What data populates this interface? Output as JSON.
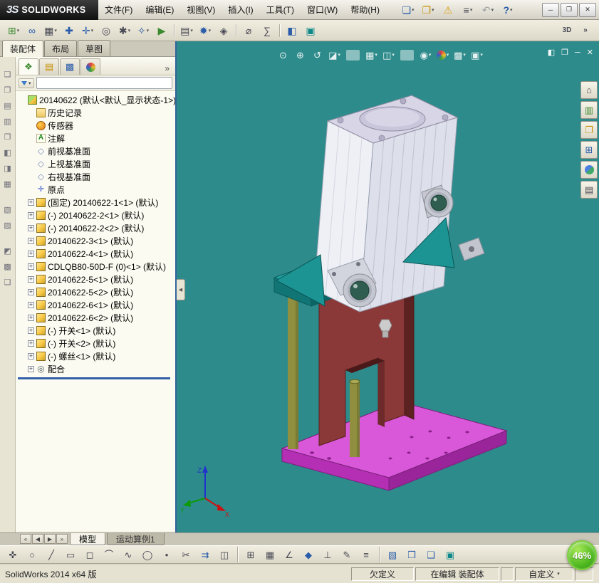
{
  "window": {
    "logo_prefix": "3S",
    "logo_text": "SOLIDWORKS",
    "controls": [
      {
        "name": "minimize-button",
        "g": "─"
      },
      {
        "name": "maximize-button",
        "g": "❐"
      },
      {
        "name": "close-button",
        "g": "✕"
      }
    ]
  },
  "menubar": {
    "items": [
      "文件(F)",
      "编辑(E)",
      "视图(V)",
      "插入(I)",
      "工具(T)",
      "窗口(W)",
      "帮助(H)"
    ]
  },
  "quickbar": {
    "icons": [
      {
        "name": "new-document-icon",
        "g": "❏",
        "c": "c-blue",
        "caret": "▾"
      },
      {
        "name": "open-document-icon",
        "g": "❐",
        "c": "c-gold",
        "caret": "▾"
      },
      {
        "name": "alert-icon",
        "g": "⚠",
        "c": "c-warn"
      },
      {
        "name": "print-icon",
        "g": "≡",
        "c": "c-dark",
        "caret": "▾"
      },
      {
        "name": "undo-icon",
        "g": "↶",
        "c": "c-gray",
        "caret": "▾"
      },
      {
        "name": "help-icon",
        "g": "?",
        "c": "c-help",
        "caret": "▾"
      }
    ]
  },
  "toolbar2": {
    "icons": [
      {
        "name": "insert-components-icon",
        "g": "⊞",
        "c": "c-green",
        "caret": "▾"
      },
      {
        "name": "mate-icon",
        "g": "∞",
        "c": "c-blue"
      },
      {
        "name": "linear-component-pattern-icon",
        "g": "▦",
        "c": "c-dark",
        "caret": "▾"
      },
      {
        "name": "smart-fasteners-icon",
        "g": "✚",
        "c": "c-blue"
      },
      {
        "name": "move-component-icon",
        "g": "✛",
        "c": "c-blue",
        "caret": "▾"
      },
      {
        "name": "show-hidden-components-icon",
        "g": "◎",
        "c": "c-dark"
      },
      {
        "name": "assembly-features-icon",
        "g": "✱",
        "c": "c-dark",
        "caret": "▾"
      },
      {
        "name": "reference-geometry-icon",
        "g": "✧",
        "c": "c-blue",
        "caret": "▾"
      },
      {
        "name": "new-motion-study-icon",
        "g": "▶",
        "c": "c-green"
      },
      {
        "name": "separator",
        "cls": "sep",
        "inter": false
      },
      {
        "name": "bill-of-materials-icon",
        "g": "▤",
        "c": "c-dark",
        "caret": "▾"
      },
      {
        "name": "exploded-view-icon",
        "g": "✹",
        "c": "c-blue",
        "caret": "▾"
      },
      {
        "name": "interference-detection-icon",
        "g": "◈",
        "c": "c-dark"
      },
      {
        "name": "separator",
        "cls": "sep",
        "inter": false
      },
      {
        "name": "measure-icon",
        "g": "⌀",
        "c": "c-dark"
      },
      {
        "name": "mass-properties-icon",
        "g": "∑",
        "c": "c-dark"
      },
      {
        "name": "separator",
        "cls": "sep",
        "inter": false
      },
      {
        "name": "section-view-tool-icon",
        "g": "◧",
        "c": "c-blue"
      },
      {
        "name": "camera-views-icon",
        "g": "▣",
        "c": "c-teal"
      }
    ],
    "right_icons": [
      {
        "name": "standard-views-icon",
        "g": "3D",
        "c": "c-dark"
      },
      {
        "name": "toolbar-overflow-icon",
        "g": "»",
        "c": "c-dark"
      }
    ]
  },
  "command_tabs": {
    "tabs": [
      {
        "name": "tab-assembly",
        "label": "装配体",
        "cls": "active"
      },
      {
        "name": "tab-layout",
        "label": "布局"
      },
      {
        "name": "tab-sketch",
        "label": "草图"
      }
    ]
  },
  "side_toolbar": {
    "icons": [
      {
        "name": "side-toolbar-button-1",
        "g": "❏"
      },
      {
        "name": "side-toolbar-button-2",
        "g": "❒"
      },
      {
        "name": "side-toolbar-button-3",
        "g": "▤"
      },
      {
        "name": "side-toolbar-button-4",
        "g": "▥"
      },
      {
        "name": "side-toolbar-button-5",
        "g": "❐"
      },
      {
        "name": "side-toolbar-button-6",
        "g": "◧"
      },
      {
        "name": "side-toolbar-button-7",
        "g": "◨"
      },
      {
        "name": "side-toolbar-button-8",
        "g": "▦"
      },
      {
        "name": "separator",
        "cls": "vsep",
        "inter": false
      },
      {
        "name": "side-toolbar-button-9",
        "g": "▧"
      },
      {
        "name": "side-toolbar-button-10",
        "g": "▨"
      },
      {
        "name": "separator",
        "cls": "vsep",
        "inter": false
      },
      {
        "name": "side-toolbar-button-11",
        "g": "◩"
      },
      {
        "name": "side-toolbar-button-12",
        "g": "▩"
      },
      {
        "name": "side-toolbar-button-13",
        "g": "❑"
      }
    ]
  },
  "feature_manager": {
    "tabs": [
      {
        "name": "featuremanager-tree-tab",
        "g": "❖",
        "c": "c-green",
        "cls": "active"
      },
      {
        "name": "propertymanager-tab",
        "g": "▤",
        "c": "c-gold"
      },
      {
        "name": "configurationmanager-tab",
        "g": "▩",
        "c": "c-blue"
      },
      {
        "name": "displaymanager-tab",
        "g": "●",
        "c": "ball-multi"
      }
    ],
    "overflow": "»",
    "filter_caret": "▾",
    "items": [
      {
        "label": "20140622 (默认<默认_显示状态-1>)",
        "icon": "ic-asm",
        "ind": "ind0",
        "exp": "",
        "g": ""
      },
      {
        "label": "历史记录",
        "icon": "ic-hist",
        "ind": "ind1",
        "exp": "",
        "g": ""
      },
      {
        "label": "传感器",
        "icon": "ic-sensor",
        "ind": "ind1",
        "exp": "",
        "g": ""
      },
      {
        "label": "注解",
        "icon": "ic-ann",
        "ind": "ind1",
        "exp": "",
        "g": "A"
      },
      {
        "label": "前视基准面",
        "icon": "ic-plane",
        "ind": "ind1",
        "exp": "",
        "g": "◇"
      },
      {
        "label": "上视基准面",
        "icon": "ic-plane",
        "ind": "ind1",
        "exp": "",
        "g": "◇"
      },
      {
        "label": "右视基准面",
        "icon": "ic-plane",
        "ind": "ind1",
        "exp": "",
        "g": "◇"
      },
      {
        "label": "原点",
        "icon": "ic-origin",
        "ind": "ind1",
        "exp": "",
        "g": "✛"
      },
      {
        "label": "(固定) 20140622-1<1> (默认)",
        "icon": "ic-part",
        "ind": "ind1",
        "exp": "+",
        "g": ""
      },
      {
        "label": "(-) 20140622-2<1> (默认)",
        "icon": "ic-part",
        "ind": "ind1",
        "exp": "+",
        "g": ""
      },
      {
        "label": "(-) 20140622-2<2> (默认)",
        "icon": "ic-part",
        "ind": "ind1",
        "exp": "+",
        "g": ""
      },
      {
        "label": "20140622-3<1> (默认)",
        "icon": "ic-part",
        "ind": "ind1",
        "exp": "+",
        "g": ""
      },
      {
        "label": "20140622-4<1> (默认)",
        "icon": "ic-part",
        "ind": "ind1",
        "exp": "+",
        "g": ""
      },
      {
        "label": "CDLQB80-50D-F (0)<1> (默认)",
        "icon": "ic-part",
        "ind": "ind1",
        "exp": "+",
        "g": ""
      },
      {
        "label": "20140622-5<1> (默认)",
        "icon": "ic-part",
        "ind": "ind1",
        "exp": "+",
        "g": ""
      },
      {
        "label": "20140622-5<2> (默认)",
        "icon": "ic-part",
        "ind": "ind1",
        "exp": "+",
        "g": ""
      },
      {
        "label": "20140622-6<1> (默认)",
        "icon": "ic-part",
        "ind": "ind1",
        "exp": "+",
        "g": ""
      },
      {
        "label": "20140622-6<2> (默认)",
        "icon": "ic-part",
        "ind": "ind1",
        "exp": "+",
        "g": ""
      },
      {
        "label": "(-) 开关<1> (默认)",
        "icon": "ic-part",
        "ind": "ind1",
        "exp": "+",
        "g": ""
      },
      {
        "label": "(-) 开关<2> (默认)",
        "icon": "ic-part",
        "ind": "ind1",
        "exp": "+",
        "g": ""
      },
      {
        "label": "(-) 螺丝<1> (默认)",
        "icon": "ic-part",
        "ind": "ind1",
        "exp": "+",
        "g": ""
      },
      {
        "label": "配合",
        "icon": "ic-mate",
        "ind": "ind1",
        "exp": "+",
        "g": "◎"
      }
    ]
  },
  "viewport": {
    "background": "#2e8b8b",
    "collapse_arrow": "◀",
    "hud": [
      {
        "name": "zoom-fit-icon",
        "g": "⊙"
      },
      {
        "name": "zoom-area-icon",
        "g": "⊕"
      },
      {
        "name": "previous-view-icon",
        "g": "↺"
      },
      {
        "name": "section-view-icon",
        "g": "◪",
        "caret": "▾"
      },
      {
        "name": "separator",
        "cls": "sep",
        "inter": false
      },
      {
        "name": "view-orientation-icon",
        "g": "▦",
        "caret": "▾"
      },
      {
        "name": "display-style-icon",
        "g": "◫",
        "caret": "▾"
      },
      {
        "name": "separator",
        "cls": "sep",
        "inter": false
      },
      {
        "name": "hide-show-items-icon",
        "g": "◉",
        "caret": "▾"
      },
      {
        "name": "edit-appearance-icon",
        "g": "●",
        "c": "ball-multi",
        "caret": "▾"
      },
      {
        "name": "apply-scene-icon",
        "g": "▩",
        "caret": "▾"
      },
      {
        "name": "view-settings-icon",
        "g": "▣",
        "caret": "▾"
      }
    ],
    "window_controls": [
      {
        "name": "viewport-previous-window-icon",
        "g": "◧"
      },
      {
        "name": "viewport-restore-icon",
        "g": "❐"
      },
      {
        "name": "viewport-minimize-icon",
        "g": "─"
      },
      {
        "name": "viewport-close-icon",
        "g": "✕"
      }
    ],
    "taskpane": [
      {
        "name": "solidworks-resources-icon",
        "g": "⌂",
        "c": "c-dark"
      },
      {
        "name": "design-library-icon",
        "g": "▥",
        "c": "c-green"
      },
      {
        "name": "file-explorer-icon",
        "g": "❐",
        "c": "c-gold"
      },
      {
        "name": "view-palette-icon",
        "g": "⊞",
        "c": "c-blue"
      },
      {
        "name": "appearances-scenes-icon",
        "g": "●",
        "c": "ball-rb"
      },
      {
        "name": "custom-properties-icon",
        "g": "▤",
        "c": "c-dark"
      }
    ]
  },
  "triad": {
    "x": "X",
    "y": "Y",
    "z": "Z"
  },
  "model_colors": {
    "base_top": "#d958d9",
    "base_front": "#b52fb5",
    "base_side": "#9a259a",
    "column_front": "#8a3838",
    "column_side": "#5c2222",
    "column_top": "#a85252",
    "rod": "#8f8f3f",
    "rod_light": "#a8a856",
    "bracket_top": "#23a3a3",
    "bracket_front": "#127575",
    "bracket_side": "#0d6666",
    "gusset": "#1d9494",
    "cyl_left": "#eef0f6",
    "cyl_right": "#dde0ea",
    "cyl_top": "#d8d5e6",
    "boss": "#c9c5db",
    "sensor_face": "#2f5d4f",
    "sensor_ring": "#c4c7cf",
    "plate_brown": "#b06a20",
    "flange": "#d2d5dd"
  },
  "bottom_tabs": {
    "nav": [
      {
        "name": "tab-scroll-first-icon",
        "g": "«"
      },
      {
        "name": "tab-scroll-prev-icon",
        "g": "◀"
      },
      {
        "name": "tab-scroll-next-icon",
        "g": "▶"
      },
      {
        "name": "tab-scroll-last-icon",
        "g": "»"
      }
    ],
    "tabs": [
      {
        "name": "tab-model",
        "label": "模型",
        "cls": "active"
      },
      {
        "name": "tab-motion-study-1",
        "label": "运动算例1"
      }
    ]
  },
  "bottom_toolbar": {
    "icons": [
      {
        "name": "smart-dimension-icon",
        "g": "✜",
        "c": "c-dark"
      },
      {
        "name": "circle-tool-icon",
        "g": "○",
        "c": "c-dark"
      },
      {
        "name": "line-tool-icon",
        "g": "╱",
        "c": "c-dark"
      },
      {
        "name": "corner-rectangle-icon",
        "g": "▭",
        "c": "c-dark"
      },
      {
        "name": "straight-slot-icon",
        "g": "◻",
        "c": "c-dark"
      },
      {
        "name": "arc-tool-icon",
        "g": "⌒",
        "c": "c-dark"
      },
      {
        "name": "spline-tool-icon",
        "g": "∿",
        "c": "c-dark"
      },
      {
        "name": "ellipse-tool-icon",
        "g": "◯",
        "c": "c-dark"
      },
      {
        "name": "point-tool-icon",
        "g": "•",
        "c": "c-dark"
      },
      {
        "name": "trim-entities-icon",
        "g": "✂",
        "c": "c-dark"
      },
      {
        "name": "convert-entities-icon",
        "g": "⇉",
        "c": "c-blue"
      },
      {
        "name": "mirror-entities-icon",
        "g": "◫",
        "c": "c-dark"
      },
      {
        "name": "separator",
        "cls": "sep",
        "inter": false
      },
      {
        "name": "sketch-pattern-icon",
        "g": "⊞",
        "c": "c-dark"
      },
      {
        "name": "grid-snap-icon",
        "g": "▦",
        "c": "c-dark"
      },
      {
        "name": "angle-tool-icon",
        "g": "∠",
        "c": "c-dark"
      },
      {
        "name": "add-relation-icon",
        "g": "◆",
        "c": "c-blue"
      },
      {
        "name": "perpendicular-relation-icon",
        "g": "⊥",
        "c": "c-dark"
      },
      {
        "name": "attachment-icon",
        "g": "✎",
        "c": "c-dark"
      },
      {
        "name": "line-format-icon",
        "g": "≡",
        "c": "c-dark"
      },
      {
        "name": "separator",
        "cls": "sep",
        "inter": false
      },
      {
        "name": "rapid-sketch-icon",
        "g": "▧",
        "c": "c-blue"
      },
      {
        "name": "shaded-contours-icon",
        "g": "❒",
        "c": "c-blue"
      },
      {
        "name": "instant3d-icon",
        "g": "❑",
        "c": "c-blue"
      },
      {
        "name": "large-assembly-mode-icon",
        "g": "▣",
        "c": "c-teal"
      }
    ]
  },
  "statusbar": {
    "left": "SolidWorks 2014 x64 版",
    "cells": [
      {
        "name": "status-underdefined",
        "label": "欠定义",
        "w": "w90",
        "inter": false
      },
      {
        "name": "status-editing",
        "label": "在编辑 装配体",
        "w": "w120",
        "inter": false
      },
      {
        "name": "status-empty-1",
        "label": "",
        "w": "w20",
        "inter": false
      },
      {
        "name": "status-custom",
        "label": "自定义",
        "caret": "▾",
        "w": "w84",
        "inter": true
      },
      {
        "name": "status-empty-2",
        "label": "",
        "w": "w26",
        "inter": false
      }
    ]
  },
  "badge": {
    "label": "46%"
  }
}
